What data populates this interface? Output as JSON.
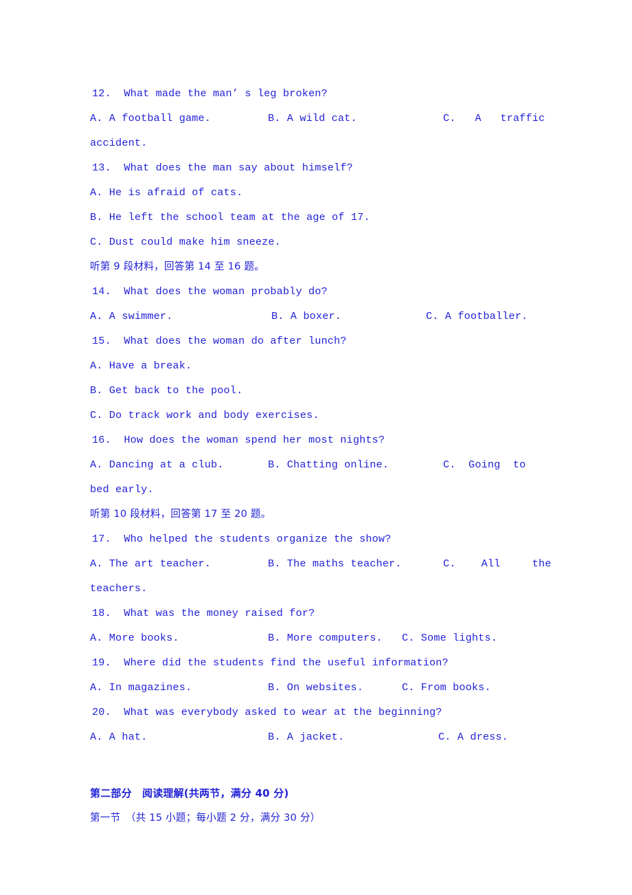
{
  "document": {
    "language": "zh-CN + en",
    "text_color": "#2222d6",
    "background_color": "#ffffff"
  },
  "listening": {
    "questions": [
      {
        "number": "12.",
        "stem": "12.  What made the man’ s leg broken?",
        "options": {
          "a": "A. A football game.",
          "b": "B. A wild cat.",
          "c": "C.   A   traffic",
          "c_wrap": "accident."
        }
      },
      {
        "number": "13.",
        "stem": "13.  What does the man say about himself?",
        "options": {
          "a": "A. He is afraid of cats.",
          "b": "B. He left the school team at the age of 17.",
          "c": "C. Dust could make him sneeze."
        }
      },
      {
        "number": "14.",
        "stem": "14.  What does the woman probably do?",
        "options": {
          "a": "A. A swimmer.",
          "b": "B. A boxer.",
          "c": "C. A footballer."
        }
      },
      {
        "number": "15.",
        "stem": "15.  What does the woman do after lunch?",
        "options": {
          "a": "A. Have a break.",
          "b": "B. Get back to the pool.",
          "c": "C. Do track work and body exercises."
        }
      },
      {
        "number": "16.",
        "stem": "16.  How does the woman spend her most nights?",
        "options": {
          "a": "A. Dancing at a club.",
          "b": "B. Chatting online.",
          "c": "C.  Going  to",
          "c_wrap": "bed early."
        }
      },
      {
        "number": "17.",
        "stem": "17.  Who helped the students organize the show?",
        "options": {
          "a": "A. The art teacher.",
          "b": "B. The maths teacher.",
          "c": "C.    All     the",
          "c_wrap": "teachers."
        }
      },
      {
        "number": "18.",
        "stem": "18.  What was the money raised for?",
        "options": {
          "a": "A. More books.",
          "b": "B. More computers.",
          "c": "C. Some lights."
        }
      },
      {
        "number": "19.",
        "stem": "19.  Where did the students find the useful information?",
        "options": {
          "a": "A. In magazines.",
          "b": "B. On websites.",
          "c": "C. From books."
        }
      },
      {
        "number": "20.",
        "stem": "20.  What was everybody asked to wear at the beginning?",
        "options": {
          "a": "A. A hat.",
          "b": "B. A jacket.",
          "c": "C. A dress."
        }
      }
    ],
    "instructions": {
      "material_9": "听第 9 段材料，回答第 14 至 16 题。",
      "material_10": "听第 10 段材料，回答第 17 至 20 题。"
    }
  },
  "reading_section": {
    "part_heading": "第二部分　阅读理解(共两节，满分 40 分)",
    "subsection_heading": "第一节　（共 15 小题；每小题 2 分，满分 30 分）"
  }
}
